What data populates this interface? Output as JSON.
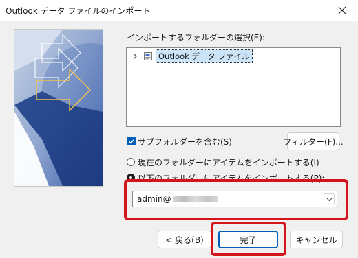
{
  "window": {
    "title": "Outlook データ ファイルのインポート"
  },
  "folder_select": {
    "label": "インポートするフォルダーの選択(E):",
    "tree_item": "Outlook データ ファイル"
  },
  "subfolders": {
    "label": "サブフォルダーを含む(S)",
    "checked": true
  },
  "filter_button": "フィルター(F)...",
  "options": [
    {
      "label": "現在のフォルダーにアイテムをインポートする(I)",
      "selected": false
    },
    {
      "label": "以下のフォルダーにアイテムをインポートする(P):",
      "selected": true
    }
  ],
  "target_folder": {
    "value": "admin@"
  },
  "buttons": {
    "back": "< 戻る(B)",
    "finish": "完了",
    "cancel": "キャンセル"
  },
  "colors": {
    "accent": "#005fb8",
    "highlight": "#d2141b"
  },
  "icons": [
    "close-icon",
    "chevron-right-icon",
    "data-file-icon",
    "checkmark-icon",
    "chevron-down-icon"
  ]
}
